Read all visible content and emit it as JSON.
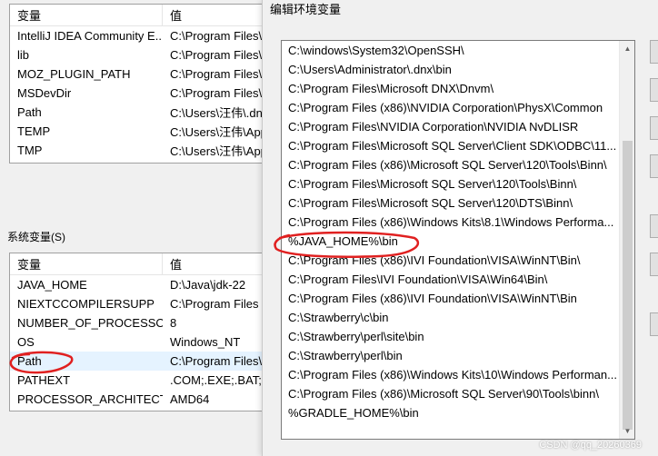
{
  "user_vars": {
    "header": {
      "name": "变量",
      "value": "值"
    },
    "rows": [
      {
        "name": "IntelliJ IDEA Community E...",
        "value": "C:\\Program Files\\"
      },
      {
        "name": "lib",
        "value": "C:\\Program Files\\"
      },
      {
        "name": "MOZ_PLUGIN_PATH",
        "value": "C:\\Program Files\\"
      },
      {
        "name": "MSDevDir",
        "value": "C:\\Program Files\\"
      },
      {
        "name": "Path",
        "value": "C:\\Users\\汪伟\\.dn"
      },
      {
        "name": "TEMP",
        "value": "C:\\Users\\汪伟\\App"
      },
      {
        "name": "TMP",
        "value": "C:\\Users\\汪伟\\App"
      }
    ]
  },
  "system_vars": {
    "label": "系统变量(S)",
    "header": {
      "name": "变量",
      "value": "值"
    },
    "rows": [
      {
        "name": "JAVA_HOME",
        "value": "D:\\Java\\jdk-22"
      },
      {
        "name": "NIEXTCCOMPILERSUPP",
        "value": "C:\\Program Files"
      },
      {
        "name": "NUMBER_OF_PROCESSORS",
        "value": "8"
      },
      {
        "name": "OS",
        "value": "Windows_NT"
      },
      {
        "name": "Path",
        "value": "C:\\Program Files\\"
      },
      {
        "name": "PATHEXT",
        "value": ".COM;.EXE;.BAT;.C"
      },
      {
        "name": "PROCESSOR_ARCHITECT...",
        "value": "AMD64"
      }
    ]
  },
  "edit_dialog": {
    "title": "编辑环境变量",
    "entries": [
      "C:\\windows\\System32\\OpenSSH\\",
      "C:\\Users\\Administrator\\.dnx\\bin",
      "C:\\Program Files\\Microsoft DNX\\Dnvm\\",
      "C:\\Program Files (x86)\\NVIDIA Corporation\\PhysX\\Common",
      "C:\\Program Files\\NVIDIA Corporation\\NVIDIA NvDLISR",
      "C:\\Program Files\\Microsoft SQL Server\\Client SDK\\ODBC\\11...",
      "C:\\Program Files (x86)\\Microsoft SQL Server\\120\\Tools\\Binn\\",
      "C:\\Program Files\\Microsoft SQL Server\\120\\Tools\\Binn\\",
      "C:\\Program Files\\Microsoft SQL Server\\120\\DTS\\Binn\\",
      "C:\\Program Files (x86)\\Windows Kits\\8.1\\Windows Performa...",
      "%JAVA_HOME%\\bin",
      "C:\\Program Files (x86)\\IVI Foundation\\VISA\\WinNT\\Bin\\",
      "C:\\Program Files\\IVI Foundation\\VISA\\Win64\\Bin\\",
      "C:\\Program Files (x86)\\IVI Foundation\\VISA\\WinNT\\Bin",
      "C:\\Strawberry\\c\\bin",
      "C:\\Strawberry\\perl\\site\\bin",
      "C:\\Strawberry\\perl\\bin",
      "C:\\Program Files (x86)\\Windows Kits\\10\\Windows Performan...",
      "C:\\Program Files (x86)\\Microsoft SQL Server\\90\\Tools\\binn\\",
      "%GRADLE_HOME%\\bin"
    ]
  },
  "colors": {
    "annotation": "#e02020",
    "selection": "#e5f3ff"
  },
  "watermark": "CSDN @qq_20260369"
}
